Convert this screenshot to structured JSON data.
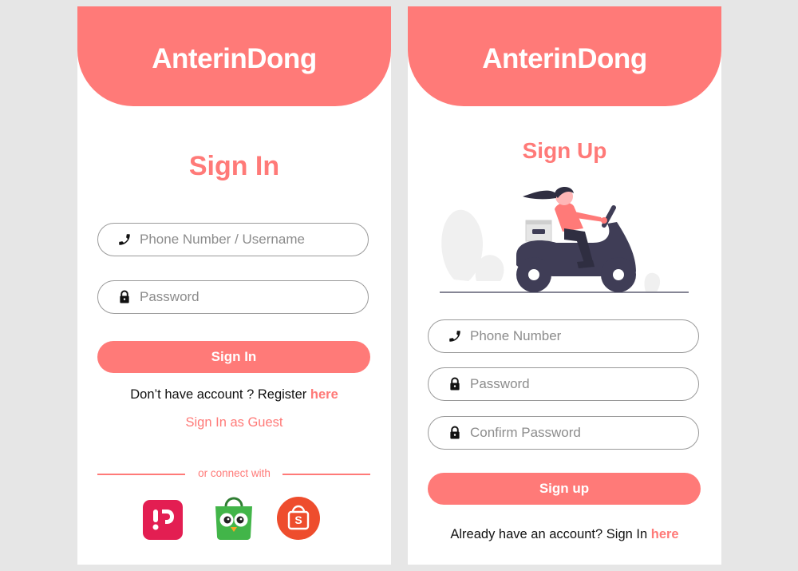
{
  "signin": {
    "brand": "AnterinDong",
    "title": "Sign In",
    "phone_placeholder": "Phone Number / Username",
    "password_placeholder": "Password",
    "submit_label": "Sign In",
    "register_prompt": "Don’t have account ? Register ",
    "register_link": "here",
    "guest_label": "Sign In as Guest",
    "connect_label": "or connect with",
    "social": [
      {
        "name": "bukalapak",
        "icon": "bukalapak-logo-icon",
        "color": "#e31e52"
      },
      {
        "name": "tokopedia",
        "icon": "tokopedia-logo-icon",
        "color": "#42b549"
      },
      {
        "name": "shopee",
        "icon": "shopee-logo-icon",
        "color": "#ee4d2d",
        "glyph": "S"
      }
    ]
  },
  "signup": {
    "brand": "AnterinDong",
    "title": "Sign Up",
    "illustration": "delivery-scooter-illustration",
    "phone_placeholder": "Phone Number",
    "password_placeholder": "Password",
    "confirm_placeholder": "Confirm Password",
    "submit_label": "Sign up",
    "signin_prompt": "Already have an account? Sign In ",
    "signin_link": "here"
  },
  "theme": {
    "accent": "#ff7a78",
    "background": "#e6e6e6",
    "card": "#ffffff",
    "text": "#111111",
    "placeholder": "#8c8c8c",
    "illustration_dark": "#3f3d56"
  },
  "icons": {
    "phone": "phone-icon",
    "lock": "lock-icon"
  }
}
